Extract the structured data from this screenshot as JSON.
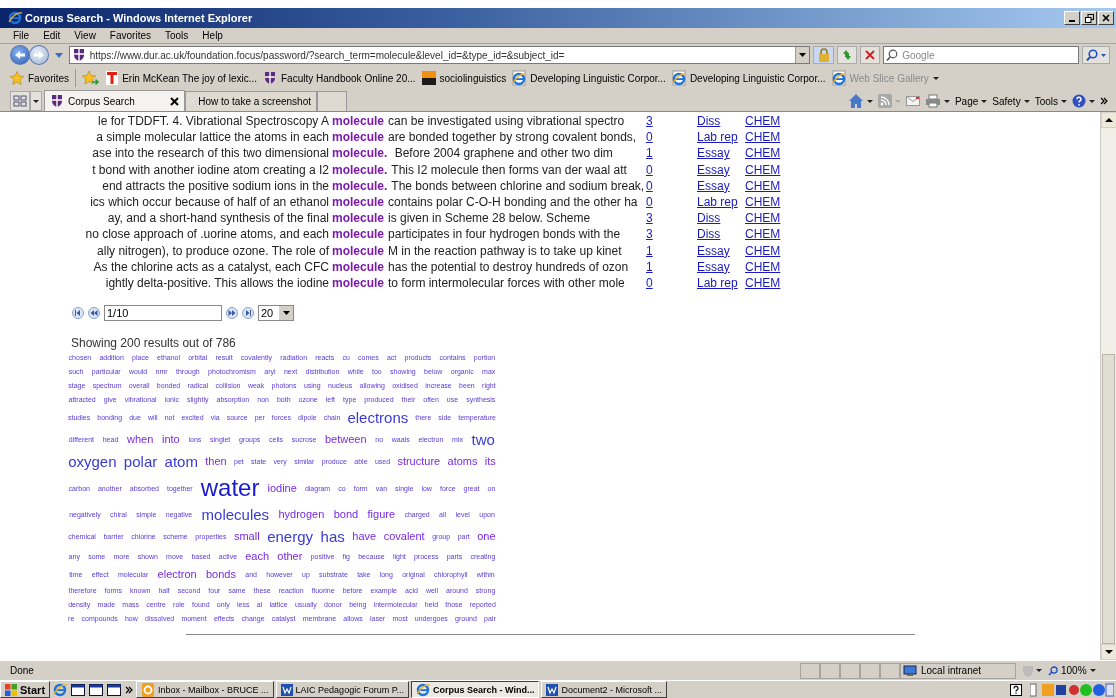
{
  "window": {
    "title": "Corpus Search - Windows Internet Explorer"
  },
  "menu": [
    "File",
    "Edit",
    "View",
    "Favorites",
    "Tools",
    "Help"
  ],
  "address": {
    "url": "https://www.dur.ac.uk/foundation.focus/password/?search_term=molecule&level_id=&type_id=&subject_id="
  },
  "search": {
    "placeholder": "Google"
  },
  "favorites": {
    "label": "Favorites",
    "items": [
      {
        "label": "Erin McKean The joy of lexic...",
        "kind": "letter"
      },
      {
        "label": "Faculty Handbook Online 20...",
        "kind": "shield"
      },
      {
        "label": "sociolinguistics",
        "kind": "square"
      },
      {
        "label": "Developing Linguistic Corpor...",
        "kind": "page"
      },
      {
        "label": "Developing Linguistic Corpor...",
        "kind": "page"
      },
      {
        "label": "Web Slice Gallery",
        "kind": "gallery"
      }
    ]
  },
  "tabs": [
    {
      "label": "Corpus Search",
      "selected": true
    },
    {
      "label": "How to take a screenshot",
      "selected": false
    }
  ],
  "command_bar": [
    "Page",
    "Safety",
    "Tools"
  ],
  "concordance": [
    {
      "left": "le for TDDFT. 4. Vibrational Spectroscopy A",
      "keyword": "molecule",
      "right": "can be investigated using vibrational spectro",
      "count": "3",
      "type": "Diss",
      "subject": "CHEM"
    },
    {
      "left": "a simple molecular lattice the atoms in each",
      "keyword": "molecule",
      "right": "are bonded together by strong covalent bonds,",
      "count": "0",
      "type": "Lab rep",
      "subject": "CHEM"
    },
    {
      "left": "ase into the research of this two dimensional",
      "keyword": "molecule.",
      "right": " Before 2004 graphene and other two dim",
      "count": "1",
      "type": "Essay",
      "subject": "CHEM"
    },
    {
      "left": "t bond with another iodine atom creating a I2",
      "keyword": "molecule.",
      "right": "This I2 molecule then forms van der waal att",
      "count": "0",
      "type": "Essay",
      "subject": "CHEM"
    },
    {
      "left": "end attracts the positive sodium ions in the",
      "keyword": "molecule.",
      "right": "The bonds between chlorine and sodium break,",
      "count": "0",
      "type": "Essay",
      "subject": "CHEM"
    },
    {
      "left": "ics which occur because of half of an ethanol",
      "keyword": "molecule",
      "right": "contains polar C-O-H bonding and the other ha",
      "count": "0",
      "type": "Lab rep",
      "subject": "CHEM"
    },
    {
      "left": "ay, and a short-hand synthesis of the final",
      "keyword": "molecule",
      "right": "is given in Scheme 28 below. Scheme",
      "count": "3",
      "type": "Diss",
      "subject": "CHEM"
    },
    {
      "left": "no close approach of .uorine atoms, and each",
      "keyword": "molecule",
      "right": "participates in four hydrogen bonds with the",
      "count": "3",
      "type": "Diss",
      "subject": "CHEM"
    },
    {
      "left": "ally nitrogen), to produce ozone. The role of",
      "keyword": "molecule",
      "right": "M in the reaction pathway is to take up kinet",
      "count": "1",
      "type": "Essay",
      "subject": "CHEM"
    },
    {
      "left": "As the chlorine acts as a catalyst, each CFC",
      "keyword": "molecule",
      "right": "has the potential to destroy hundreds of ozon",
      "count": "1",
      "type": "Essay",
      "subject": "CHEM"
    },
    {
      "left": "ightly delta-positive. This allows the iodine",
      "keyword": "molecule",
      "right": "to form intermolecular forces with other mole",
      "count": "0",
      "type": "Lab rep",
      "subject": "CHEM"
    }
  ],
  "pager": {
    "value": "1/10",
    "page_size": "20"
  },
  "results_text": "Showing 200 results out of 786",
  "word_cloud": [
    {
      "text": "chosen",
      "kind": "sm"
    },
    {
      "text": "addition",
      "kind": "sm"
    },
    {
      "text": "place",
      "kind": "sm"
    },
    {
      "text": "ethanol",
      "kind": "sm"
    },
    {
      "text": "orbital",
      "kind": "sm"
    },
    {
      "text": "result",
      "kind": "sm"
    },
    {
      "text": "covalently",
      "kind": "sm"
    },
    {
      "text": "radiation",
      "kind": "sm"
    },
    {
      "text": "reacts",
      "kind": "sm"
    },
    {
      "text": "cu",
      "kind": "sm"
    },
    {
      "text": "comes",
      "kind": "sm"
    },
    {
      "text": "act",
      "kind": "sm"
    },
    {
      "text": "products",
      "kind": "sm"
    },
    {
      "text": "contains",
      "kind": "sm"
    },
    {
      "text": "portion",
      "kind": "sm"
    },
    {
      "text": "such",
      "kind": "sm"
    },
    {
      "text": "particular",
      "kind": "sm"
    },
    {
      "text": "would",
      "kind": "sm"
    },
    {
      "text": "nmr",
      "kind": "sm"
    },
    {
      "text": "through",
      "kind": "sm"
    },
    {
      "text": "photochromism",
      "kind": "sm"
    },
    {
      "text": "aryl",
      "kind": "sm"
    },
    {
      "text": "next",
      "kind": "sm"
    },
    {
      "text": "distribution",
      "kind": "sm"
    },
    {
      "text": "while",
      "kind": "sm"
    },
    {
      "text": "too",
      "kind": "sm"
    },
    {
      "text": "showing",
      "kind": "sm"
    },
    {
      "text": "below",
      "kind": "sm"
    },
    {
      "text": "organic",
      "kind": "sm"
    },
    {
      "text": "max",
      "kind": "sm"
    },
    {
      "text": "stage",
      "kind": "sm"
    },
    {
      "text": "spectrum",
      "kind": "sm"
    },
    {
      "text": "overall",
      "kind": "sm"
    },
    {
      "text": "bonded",
      "kind": "sm"
    },
    {
      "text": "radical",
      "kind": "sm"
    },
    {
      "text": "collision",
      "kind": "sm"
    },
    {
      "text": "weak",
      "kind": "sm"
    },
    {
      "text": "photons",
      "kind": "sm"
    },
    {
      "text": "using",
      "kind": "sm"
    },
    {
      "text": "nucleus",
      "kind": "sm"
    },
    {
      "text": "allowing",
      "kind": "sm"
    },
    {
      "text": "oxidised",
      "kind": "sm"
    },
    {
      "text": "increase",
      "kind": "sm"
    },
    {
      "text": "been",
      "kind": "sm"
    },
    {
      "text": "right",
      "kind": "sm"
    },
    {
      "text": "attracted",
      "kind": "sm"
    },
    {
      "text": "give",
      "kind": "sm"
    },
    {
      "text": "vibrational",
      "kind": "sm"
    },
    {
      "text": "ionic",
      "kind": "sm"
    },
    {
      "text": "slightly",
      "kind": "sm"
    },
    {
      "text": "absorption",
      "kind": "sm"
    },
    {
      "text": "non",
      "kind": "sm"
    },
    {
      "text": "both",
      "kind": "sm"
    },
    {
      "text": "ozone",
      "kind": "sm"
    },
    {
      "text": "left",
      "kind": "sm"
    },
    {
      "text": "type",
      "kind": "sm"
    },
    {
      "text": "produced",
      "kind": "sm"
    },
    {
      "text": "their",
      "kind": "sm"
    },
    {
      "text": "often",
      "kind": "sm"
    },
    {
      "text": "use",
      "kind": "sm"
    },
    {
      "text": "synthesis",
      "kind": "sm"
    },
    {
      "text": "studies",
      "kind": "sm"
    },
    {
      "text": "bonding",
      "kind": "sm"
    },
    {
      "text": "due",
      "kind": "sm"
    },
    {
      "text": "will",
      "kind": "sm"
    },
    {
      "text": "not",
      "kind": "sm"
    },
    {
      "text": "excited",
      "kind": "sm"
    },
    {
      "text": "via",
      "kind": "sm"
    },
    {
      "text": "source",
      "kind": "sm"
    },
    {
      "text": "per",
      "kind": "sm"
    },
    {
      "text": "forces",
      "kind": "sm"
    },
    {
      "text": "dipole",
      "kind": "sm"
    },
    {
      "text": "chain",
      "kind": "sm"
    },
    {
      "text": "electrons",
      "kind": "lg"
    },
    {
      "text": "there",
      "kind": "sm"
    },
    {
      "text": "side",
      "kind": "sm"
    },
    {
      "text": "temperature",
      "kind": "sm"
    },
    {
      "text": "different",
      "kind": "sm"
    },
    {
      "text": "head",
      "kind": "sm"
    },
    {
      "text": "when",
      "kind": "md"
    },
    {
      "text": "into",
      "kind": "md"
    },
    {
      "text": "ions",
      "kind": "sm"
    },
    {
      "text": "singlet",
      "kind": "sm"
    },
    {
      "text": "groups",
      "kind": "sm"
    },
    {
      "text": "cells",
      "kind": "sm"
    },
    {
      "text": "sucrose",
      "kind": "sm"
    },
    {
      "text": "between",
      "kind": "md"
    },
    {
      "text": "no",
      "kind": "sm"
    },
    {
      "text": "waals",
      "kind": "sm"
    },
    {
      "text": "electron",
      "kind": "sm"
    },
    {
      "text": "mix",
      "kind": "sm"
    },
    {
      "text": "two",
      "kind": "lg"
    },
    {
      "text": "oxygen",
      "kind": "lg"
    },
    {
      "text": "polar",
      "kind": "lg"
    },
    {
      "text": "atom",
      "kind": "lg"
    },
    {
      "text": "then",
      "kind": "md"
    },
    {
      "text": "pet",
      "kind": "sm"
    },
    {
      "text": "state",
      "kind": "sm"
    },
    {
      "text": "very",
      "kind": "sm"
    },
    {
      "text": "similar",
      "kind": "sm"
    },
    {
      "text": "produce",
      "kind": "sm"
    },
    {
      "text": "able",
      "kind": "sm"
    },
    {
      "text": "used",
      "kind": "sm"
    },
    {
      "text": "structure",
      "kind": "md"
    },
    {
      "text": "atoms",
      "kind": "md"
    },
    {
      "text": "its",
      "kind": "md"
    },
    {
      "text": "carbon",
      "kind": "sm"
    },
    {
      "text": "another",
      "kind": "sm"
    },
    {
      "text": "absorbed",
      "kind": "sm"
    },
    {
      "text": "together",
      "kind": "sm"
    },
    {
      "text": "water",
      "kind": "xl"
    },
    {
      "text": "iodine",
      "kind": "md"
    },
    {
      "text": "diagram",
      "kind": "sm"
    },
    {
      "text": "co",
      "kind": "sm"
    },
    {
      "text": "form",
      "kind": "sm"
    },
    {
      "text": "van",
      "kind": "sm"
    },
    {
      "text": "single",
      "kind": "sm"
    },
    {
      "text": "low",
      "kind": "sm"
    },
    {
      "text": "force",
      "kind": "sm"
    },
    {
      "text": "great",
      "kind": "sm"
    },
    {
      "text": "on",
      "kind": "sm"
    },
    {
      "text": "negatively",
      "kind": "sm"
    },
    {
      "text": "chiral",
      "kind": "sm"
    },
    {
      "text": "simple",
      "kind": "sm"
    },
    {
      "text": "negative",
      "kind": "sm"
    },
    {
      "text": "molecules",
      "kind": "lg"
    },
    {
      "text": "hydrogen",
      "kind": "md"
    },
    {
      "text": "bond",
      "kind": "md"
    },
    {
      "text": "figure",
      "kind": "md"
    },
    {
      "text": "charged",
      "kind": "sm"
    },
    {
      "text": "all",
      "kind": "sm"
    },
    {
      "text": "level",
      "kind": "sm"
    },
    {
      "text": "upon",
      "kind": "sm"
    },
    {
      "text": "chemical",
      "kind": "sm"
    },
    {
      "text": "barrier",
      "kind": "sm"
    },
    {
      "text": "chlorine",
      "kind": "sm"
    },
    {
      "text": "scheme",
      "kind": "sm"
    },
    {
      "text": "properties",
      "kind": "sm"
    },
    {
      "text": "small",
      "kind": "md"
    },
    {
      "text": "energy",
      "kind": "lg"
    },
    {
      "text": "has",
      "kind": "lg"
    },
    {
      "text": "have",
      "kind": "md"
    },
    {
      "text": "covalent",
      "kind": "md"
    },
    {
      "text": "group",
      "kind": "sm"
    },
    {
      "text": "part",
      "kind": "sm"
    },
    {
      "text": "one",
      "kind": "md"
    },
    {
      "text": "any",
      "kind": "sm"
    },
    {
      "text": "some",
      "kind": "sm"
    },
    {
      "text": "more",
      "kind": "sm"
    },
    {
      "text": "shown",
      "kind": "sm"
    },
    {
      "text": "move",
      "kind": "sm"
    },
    {
      "text": "based",
      "kind": "sm"
    },
    {
      "text": "active",
      "kind": "sm"
    },
    {
      "text": "each",
      "kind": "md"
    },
    {
      "text": "other",
      "kind": "md"
    },
    {
      "text": "positive",
      "kind": "sm"
    },
    {
      "text": "fig",
      "kind": "sm"
    },
    {
      "text": "because",
      "kind": "sm"
    },
    {
      "text": "light",
      "kind": "sm"
    },
    {
      "text": "process",
      "kind": "sm"
    },
    {
      "text": "parts",
      "kind": "sm"
    },
    {
      "text": "creating",
      "kind": "sm"
    },
    {
      "text": "time",
      "kind": "sm"
    },
    {
      "text": "effect",
      "kind": "sm"
    },
    {
      "text": "molecular",
      "kind": "sm"
    },
    {
      "text": "electron",
      "kind": "md"
    },
    {
      "text": "bonds",
      "kind": "md"
    },
    {
      "text": "and",
      "kind": "sm"
    },
    {
      "text": "however",
      "kind": "sm"
    },
    {
      "text": "up",
      "kind": "sm"
    },
    {
      "text": "substrate",
      "kind": "sm"
    },
    {
      "text": "take",
      "kind": "sm"
    },
    {
      "text": "long",
      "kind": "sm"
    },
    {
      "text": "original",
      "kind": "sm"
    },
    {
      "text": "chlorophyll",
      "kind": "sm"
    },
    {
      "text": "within",
      "kind": "sm"
    },
    {
      "text": "therefore",
      "kind": "sm"
    },
    {
      "text": "forms",
      "kind": "sm"
    },
    {
      "text": "known",
      "kind": "sm"
    },
    {
      "text": "half",
      "kind": "sm"
    },
    {
      "text": "second",
      "kind": "sm"
    },
    {
      "text": "four",
      "kind": "sm"
    },
    {
      "text": "same",
      "kind": "sm"
    },
    {
      "text": "these",
      "kind": "sm"
    },
    {
      "text": "reaction",
      "kind": "sm"
    },
    {
      "text": "fluorine",
      "kind": "sm"
    },
    {
      "text": "before",
      "kind": "sm"
    },
    {
      "text": "example",
      "kind": "sm"
    },
    {
      "text": "acid",
      "kind": "sm"
    },
    {
      "text": "well",
      "kind": "sm"
    },
    {
      "text": "around",
      "kind": "sm"
    },
    {
      "text": "strong",
      "kind": "sm"
    },
    {
      "text": "density",
      "kind": "sm"
    },
    {
      "text": "made",
      "kind": "sm"
    },
    {
      "text": "mass",
      "kind": "sm"
    },
    {
      "text": "centre",
      "kind": "sm"
    },
    {
      "text": "role",
      "kind": "sm"
    },
    {
      "text": "found",
      "kind": "sm"
    },
    {
      "text": "only",
      "kind": "sm"
    },
    {
      "text": "less",
      "kind": "sm"
    },
    {
      "text": "al",
      "kind": "sm"
    },
    {
      "text": "lattice",
      "kind": "sm"
    },
    {
      "text": "usually",
      "kind": "sm"
    },
    {
      "text": "donor",
      "kind": "sm"
    },
    {
      "text": "being",
      "kind": "sm"
    },
    {
      "text": "intermolecular",
      "kind": "sm"
    },
    {
      "text": "held",
      "kind": "sm"
    },
    {
      "text": "those",
      "kind": "sm"
    },
    {
      "text": "reported",
      "kind": "sm"
    },
    {
      "text": "re",
      "kind": "sm"
    },
    {
      "text": "compounds",
      "kind": "sm"
    },
    {
      "text": "how",
      "kind": "sm"
    },
    {
      "text": "dissolved",
      "kind": "sm"
    },
    {
      "text": "moment",
      "kind": "sm"
    },
    {
      "text": "effects",
      "kind": "sm"
    },
    {
      "text": "change",
      "kind": "sm"
    },
    {
      "text": "catalyst",
      "kind": "sm"
    },
    {
      "text": "membrane",
      "kind": "sm"
    },
    {
      "text": "allows",
      "kind": "sm"
    },
    {
      "text": "laser",
      "kind": "sm"
    },
    {
      "text": "most",
      "kind": "sm"
    },
    {
      "text": "undergoes",
      "kind": "sm"
    },
    {
      "text": "ground",
      "kind": "sm"
    },
    {
      "text": "pair",
      "kind": "sm"
    }
  ],
  "status_bar": {
    "text": "Done",
    "zone": "Local intranet",
    "zoom": "100%"
  },
  "taskbar": {
    "start": "Start",
    "tasks": [
      {
        "label": "Inbox - Mailbox - BRUCE ...",
        "kind": "mail",
        "selected": false
      },
      {
        "label": "LAIC Pedagogic Forum P...",
        "kind": "word",
        "selected": false
      },
      {
        "label": "Corpus Search - Wind...",
        "kind": "browser",
        "selected": true
      },
      {
        "label": "Document2 - Microsoft ...",
        "kind": "word",
        "selected": false
      }
    ]
  }
}
